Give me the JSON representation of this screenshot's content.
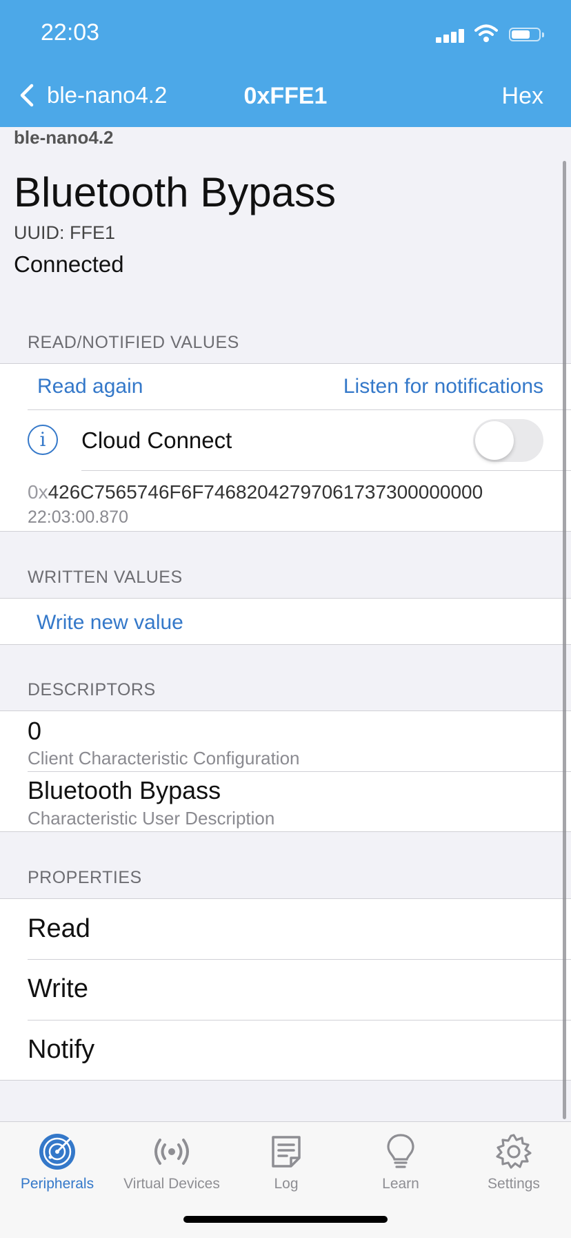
{
  "status_bar": {
    "time": "22:03"
  },
  "nav": {
    "back_label": "ble-nano4.2",
    "title": "0xFFE1",
    "right_action": "Hex"
  },
  "characteristic": {
    "device_name": "ble-nano4.2",
    "name": "Bluetooth Bypass",
    "uuid": "UUID: FFE1",
    "status": "Connected"
  },
  "read_section": {
    "header": "READ/NOTIFIED VALUES",
    "read_again": "Read again",
    "listen": "Listen for notifications",
    "cloud_connect": "Cloud Connect",
    "cloud_connect_on": false,
    "value_prefix": "0x",
    "value_hex": "426C7565746F6F74682042797061737300000000",
    "timestamp": "22:03:00.870"
  },
  "written_section": {
    "header": "WRITTEN VALUES",
    "write_new": "Write new value"
  },
  "descriptors_section": {
    "header": "DESCRIPTORS",
    "items": [
      {
        "value": "0",
        "label": "Client Characteristic Configuration"
      },
      {
        "value": "Bluetooth Bypass",
        "label": "Characteristic User Description"
      }
    ]
  },
  "properties_section": {
    "header": "PROPERTIES",
    "items": [
      "Read",
      "Write",
      "Notify"
    ]
  },
  "tabs": [
    {
      "label": "Peripherals",
      "icon": "radar-icon",
      "active": true
    },
    {
      "label": "Virtual Devices",
      "icon": "broadcast-icon",
      "active": false
    },
    {
      "label": "Log",
      "icon": "log-icon",
      "active": false
    },
    {
      "label": "Learn",
      "icon": "lightbulb-icon",
      "active": false
    },
    {
      "label": "Settings",
      "icon": "gear-icon",
      "active": false
    }
  ],
  "colors": {
    "accent": "#3478c9",
    "header": "#4ca8e8",
    "background": "#f2f2f7"
  }
}
